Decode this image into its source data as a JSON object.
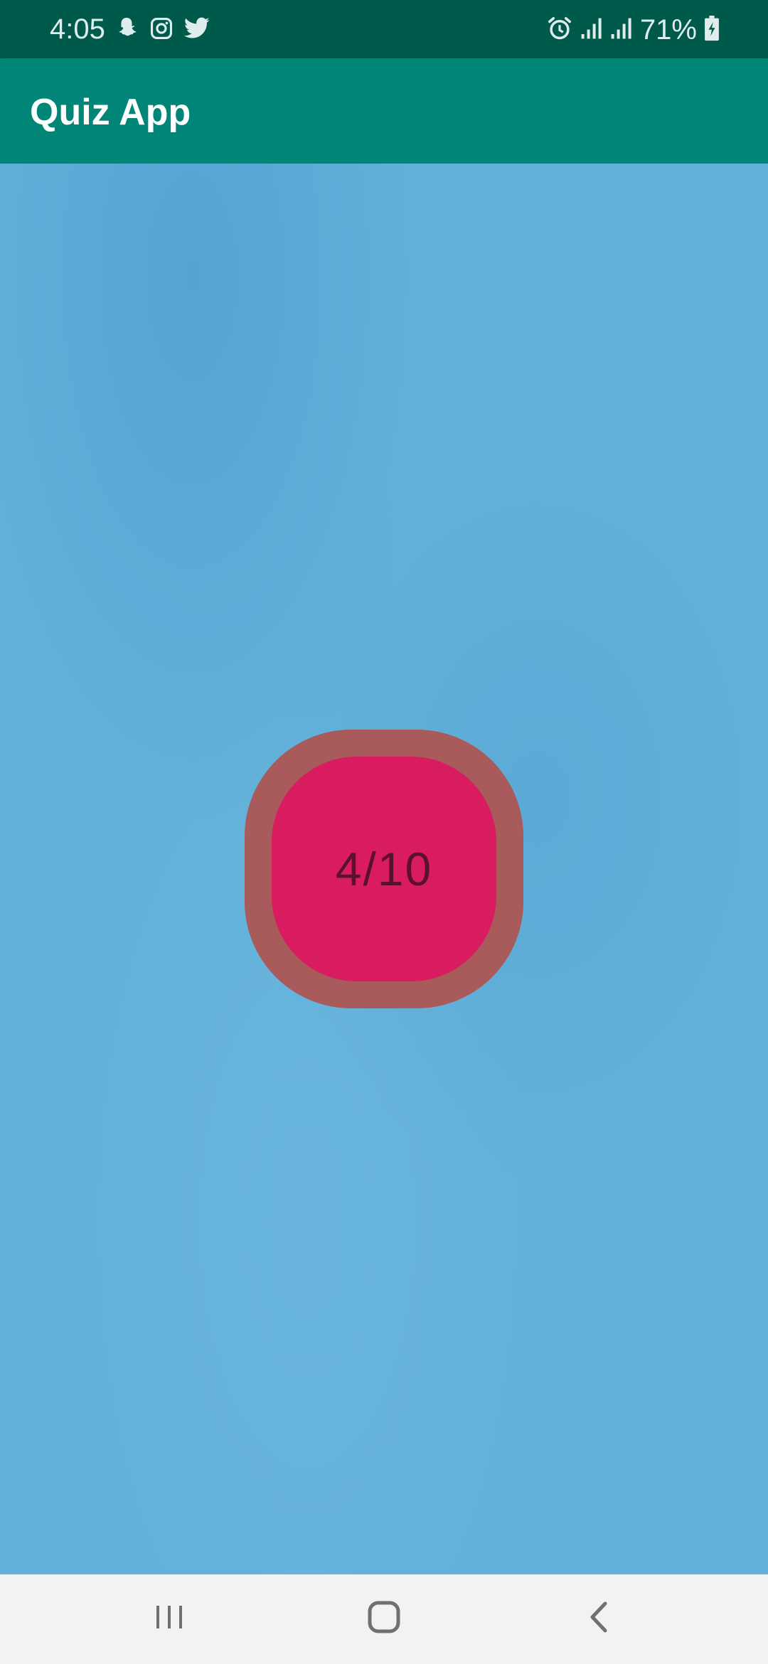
{
  "status_bar": {
    "time": "4:05",
    "battery": "71%",
    "left_icons": [
      "snapchat-icon",
      "instagram-icon",
      "twitter-icon"
    ],
    "right_icons": [
      "alarm-icon",
      "signal-icon",
      "signal-icon",
      "battery-charging-icon"
    ]
  },
  "app_bar": {
    "title": "Quiz App"
  },
  "score": {
    "text": "4/10"
  },
  "nav_bar": {
    "buttons": [
      "recent-apps-icon",
      "home-icon",
      "back-icon"
    ]
  },
  "colors": {
    "status_bar": "#005a4c",
    "app_bar": "#008577",
    "background": "#63b1d9",
    "score_ring": "#a95a5a",
    "score_fill": "#d91b60",
    "score_text": "#5a1030"
  }
}
